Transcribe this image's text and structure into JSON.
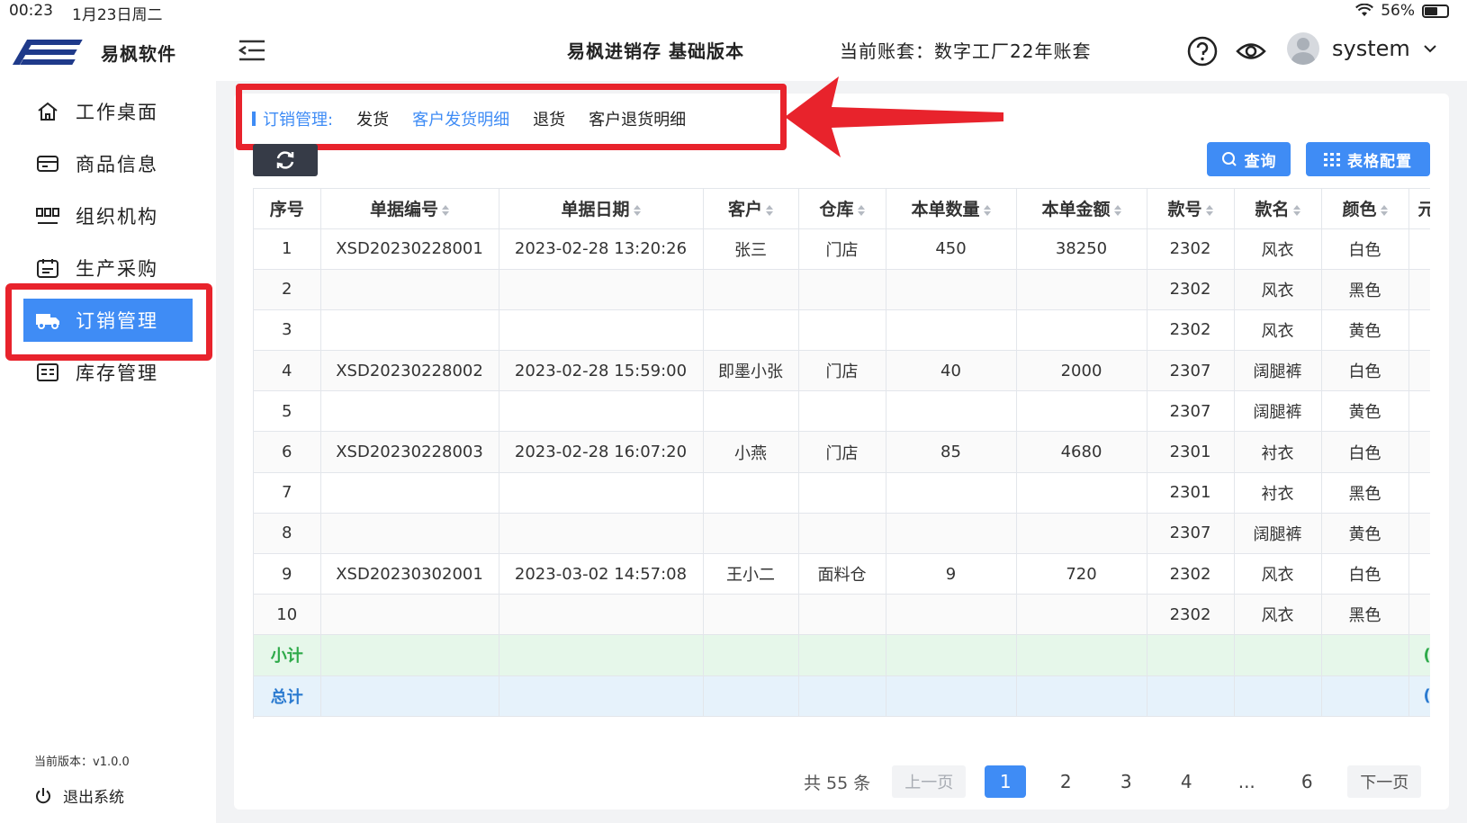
{
  "status_bar": {
    "time": "00:23",
    "date": "1月23日周二",
    "battery": "56%"
  },
  "sidebar": {
    "logo_text": "易枫软件",
    "items": [
      {
        "label": "工作桌面",
        "icon": "home-icon"
      },
      {
        "label": "商品信息",
        "icon": "product-icon"
      },
      {
        "label": "组织机构",
        "icon": "org-icon"
      },
      {
        "label": "生产采购",
        "icon": "purchase-icon"
      },
      {
        "label": "订销管理",
        "icon": "truck-icon",
        "active": true
      },
      {
        "label": "库存管理",
        "icon": "inventory-icon"
      }
    ],
    "version": "当前版本：v1.0.0",
    "logout": "退出系统"
  },
  "header": {
    "title": "易枫进销存 基础版本",
    "account": "当前账套：数字工厂22年账套",
    "user": "system"
  },
  "breadcrumb": {
    "root": "订销管理:",
    "items": [
      "发货",
      "客户发货明细",
      "退货",
      "客户退货明细"
    ],
    "active_index": 1
  },
  "toolbar": {
    "query_label": "查询",
    "config_label": "表格配置"
  },
  "table": {
    "columns": [
      "序号",
      "单据编号",
      "单据日期",
      "客户",
      "仓库",
      "本单数量",
      "本单金额",
      "款号",
      "款名",
      "颜色",
      "元"
    ],
    "rows": [
      [
        "1",
        "XSD20230228001",
        "2023-02-28 13:20:26",
        "张三",
        "门店",
        "450",
        "38250",
        "2302",
        "风衣",
        "白色",
        ""
      ],
      [
        "2",
        "",
        "",
        "",
        "",
        "",
        "",
        "2302",
        "风衣",
        "黑色",
        ""
      ],
      [
        "3",
        "",
        "",
        "",
        "",
        "",
        "",
        "2302",
        "风衣",
        "黄色",
        ""
      ],
      [
        "4",
        "XSD20230228002",
        "2023-02-28 15:59:00",
        "即墨小张",
        "门店",
        "40",
        "2000",
        "2307",
        "阔腿裤",
        "白色",
        ""
      ],
      [
        "5",
        "",
        "",
        "",
        "",
        "",
        "",
        "2307",
        "阔腿裤",
        "黄色",
        ""
      ],
      [
        "6",
        "XSD20230228003",
        "2023-02-28 16:07:20",
        "小燕",
        "门店",
        "85",
        "4680",
        "2301",
        "衬衣",
        "白色",
        ""
      ],
      [
        "7",
        "",
        "",
        "",
        "",
        "",
        "",
        "2301",
        "衬衣",
        "黑色",
        ""
      ],
      [
        "8",
        "",
        "",
        "",
        "",
        "",
        "",
        "2307",
        "阔腿裤",
        "黄色",
        ""
      ],
      [
        "9",
        "XSD20230302001",
        "2023-03-02 14:57:08",
        "王小二",
        "面料仓",
        "9",
        "720",
        "2302",
        "风衣",
        "白色",
        ""
      ],
      [
        "10",
        "",
        "",
        "",
        "",
        "",
        "",
        "2302",
        "风衣",
        "黑色",
        ""
      ]
    ],
    "subtotal_label": "小计",
    "total_label": "总计",
    "subtotal_last": "(",
    "total_last": "("
  },
  "pagination": {
    "total_text": "共 55 条",
    "prev": "上一页",
    "next": "下一页",
    "pages": [
      "1",
      "2",
      "3",
      "4",
      "...",
      "6"
    ],
    "current": "1"
  },
  "colors": {
    "accent": "#3f8cf5",
    "highlight": "#e8232c",
    "subtotal": "#2eaa4a",
    "total": "#2a7ad0"
  }
}
